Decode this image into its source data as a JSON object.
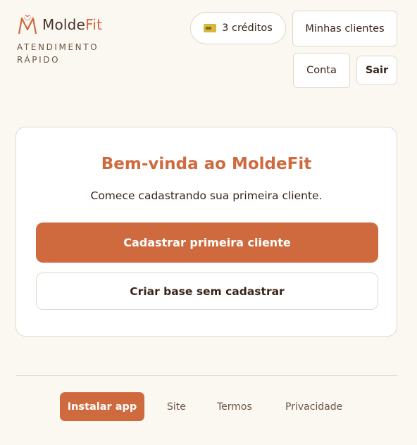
{
  "header": {
    "brand_part1": "Molde",
    "brand_part2": "Fit",
    "tagline": "ATENDIMENTO RÁPIDO",
    "credits_label": "3 créditos",
    "clients_label": "Minhas clientes",
    "account_label": "Conta",
    "logout_label": "Sair"
  },
  "card": {
    "title": "Bem-vinda ao MoldeFit",
    "subtitle": "Comece cadastrando sua primeira cliente.",
    "primary_label": "Cadastrar primeira cliente",
    "secondary_label": "Criar base sem cadastrar"
  },
  "footer": {
    "install_label": "Instalar app",
    "site_label": "Site",
    "terms_label": "Termos",
    "privacy_label": "Privacidade"
  },
  "colors": {
    "accent": "#cf6a3f",
    "background": "#fbf8f1",
    "text": "#3a2418"
  },
  "icons": {
    "logo": "moldefit-logo-icon",
    "credits": "credit-card-icon"
  }
}
